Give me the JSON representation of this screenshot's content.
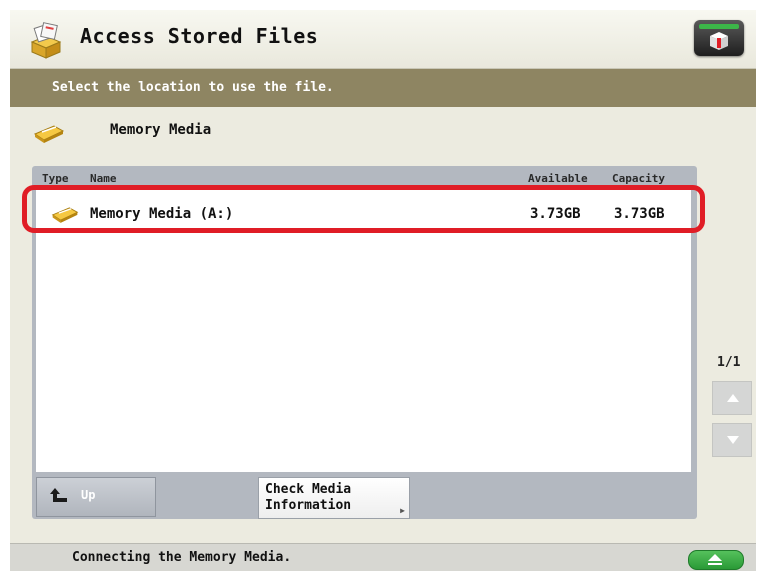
{
  "window": {
    "title": "Access Stored Files"
  },
  "banner": {
    "instruction": "Select the location to use the file."
  },
  "location": {
    "label": "Memory Media"
  },
  "file_list": {
    "columns": [
      "Type",
      "Name",
      "Available",
      "Capacity"
    ],
    "rows": [
      {
        "type_icon": "memory-media-icon",
        "name": "Memory Media (A:)",
        "available": "3.73GB",
        "capacity": "3.73GB",
        "highlighted": true
      }
    ]
  },
  "buttons": {
    "up_label": "Up",
    "check_media_line1": "Check Media",
    "check_media_line2": "Information"
  },
  "pagination": {
    "page": "1/1"
  },
  "status": {
    "message": "Connecting the Memory Media."
  },
  "colors": {
    "banner": "#8e8562",
    "highlight": "#e01d26",
    "accent_green": "#3cb649",
    "panel": "#b3b8c0"
  },
  "icons": {
    "title": "file-box-icon",
    "corner": "status-monitor-icon",
    "up": "up-arrow-icon",
    "scroll_up": "scroll-up-icon",
    "scroll_down": "scroll-down-icon",
    "eject": "eject-icon"
  }
}
